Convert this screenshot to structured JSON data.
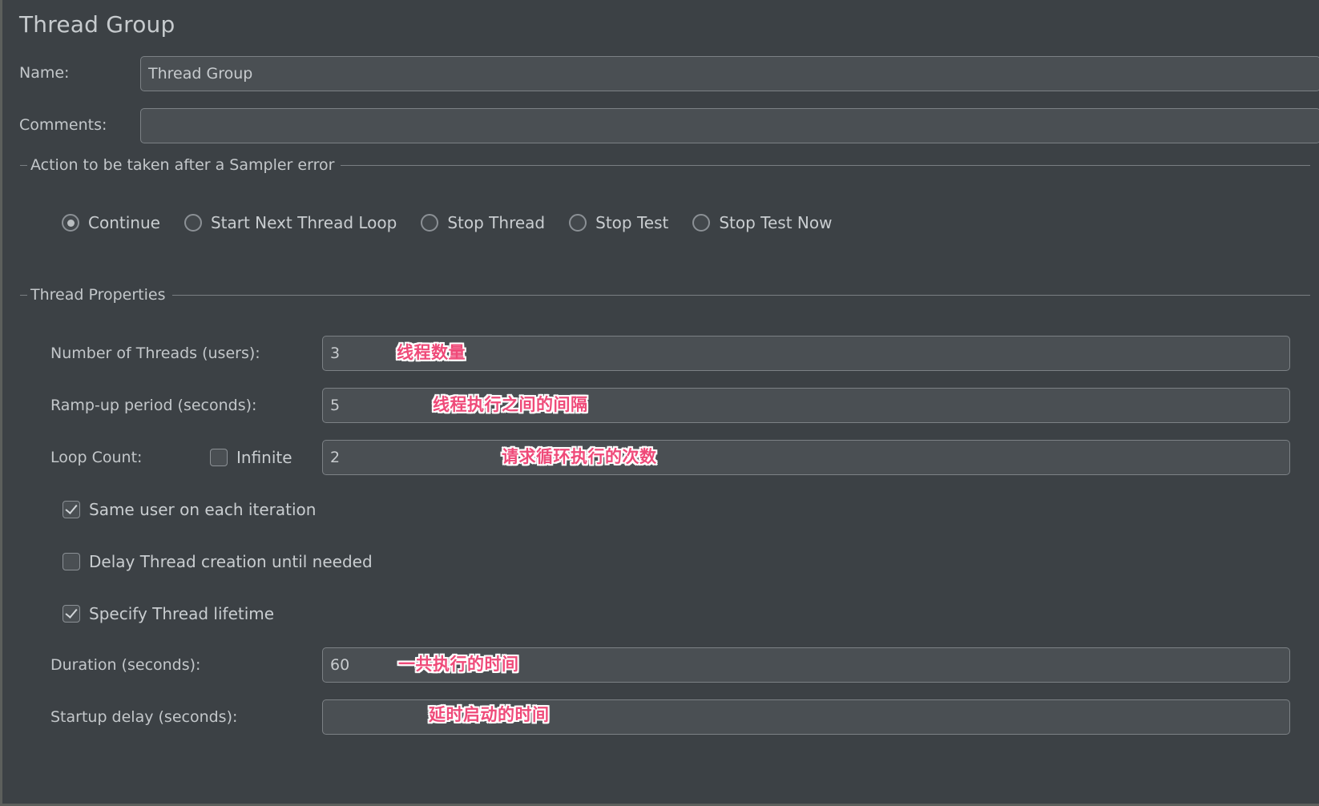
{
  "panel": {
    "title": "Thread Group"
  },
  "form": {
    "name_label": "Name:",
    "name_value": "Thread Group",
    "comments_label": "Comments:",
    "comments_value": "",
    "comments_placeholder": ""
  },
  "sampler_error": {
    "group_title": "Action to be taken after a Sampler error",
    "options": [
      {
        "label": "Continue",
        "checked": true
      },
      {
        "label": "Start Next Thread Loop",
        "checked": false
      },
      {
        "label": "Stop Thread",
        "checked": false
      },
      {
        "label": "Stop Test",
        "checked": false
      },
      {
        "label": "Stop Test Now",
        "checked": false
      }
    ]
  },
  "thread_properties": {
    "group_title": "Thread Properties",
    "num_threads_label": "Number of Threads (users):",
    "num_threads_value": "3",
    "ramp_up_label": "Ramp-up period (seconds):",
    "ramp_up_value": "5",
    "loop_count_label": "Loop Count:",
    "infinite_label": "Infinite",
    "infinite_checked": false,
    "loop_count_value": "2",
    "same_user_label": "Same user on each iteration",
    "same_user_checked": true,
    "delay_thread_label": "Delay Thread creation until needed",
    "delay_thread_checked": false,
    "specify_lifetime_label": "Specify Thread lifetime",
    "specify_lifetime_checked": true,
    "duration_label": "Duration (seconds):",
    "duration_value": "60",
    "startup_delay_label": "Startup delay (seconds):",
    "startup_delay_value": ""
  },
  "annotations": {
    "threads": "线程数量",
    "ramp_up": "线程执行之间的间隔",
    "loop_count": "请求循环执行的次数",
    "duration": "一共执行的时间",
    "startup_delay": "延时启动的时间"
  },
  "colors": {
    "background": "#3c4145",
    "field_bg": "#4a4f53",
    "field_border": "#7c8185",
    "text": "#c9cdd0",
    "annotation": "#ef4a79",
    "annotation_outline": "#ffffff"
  }
}
